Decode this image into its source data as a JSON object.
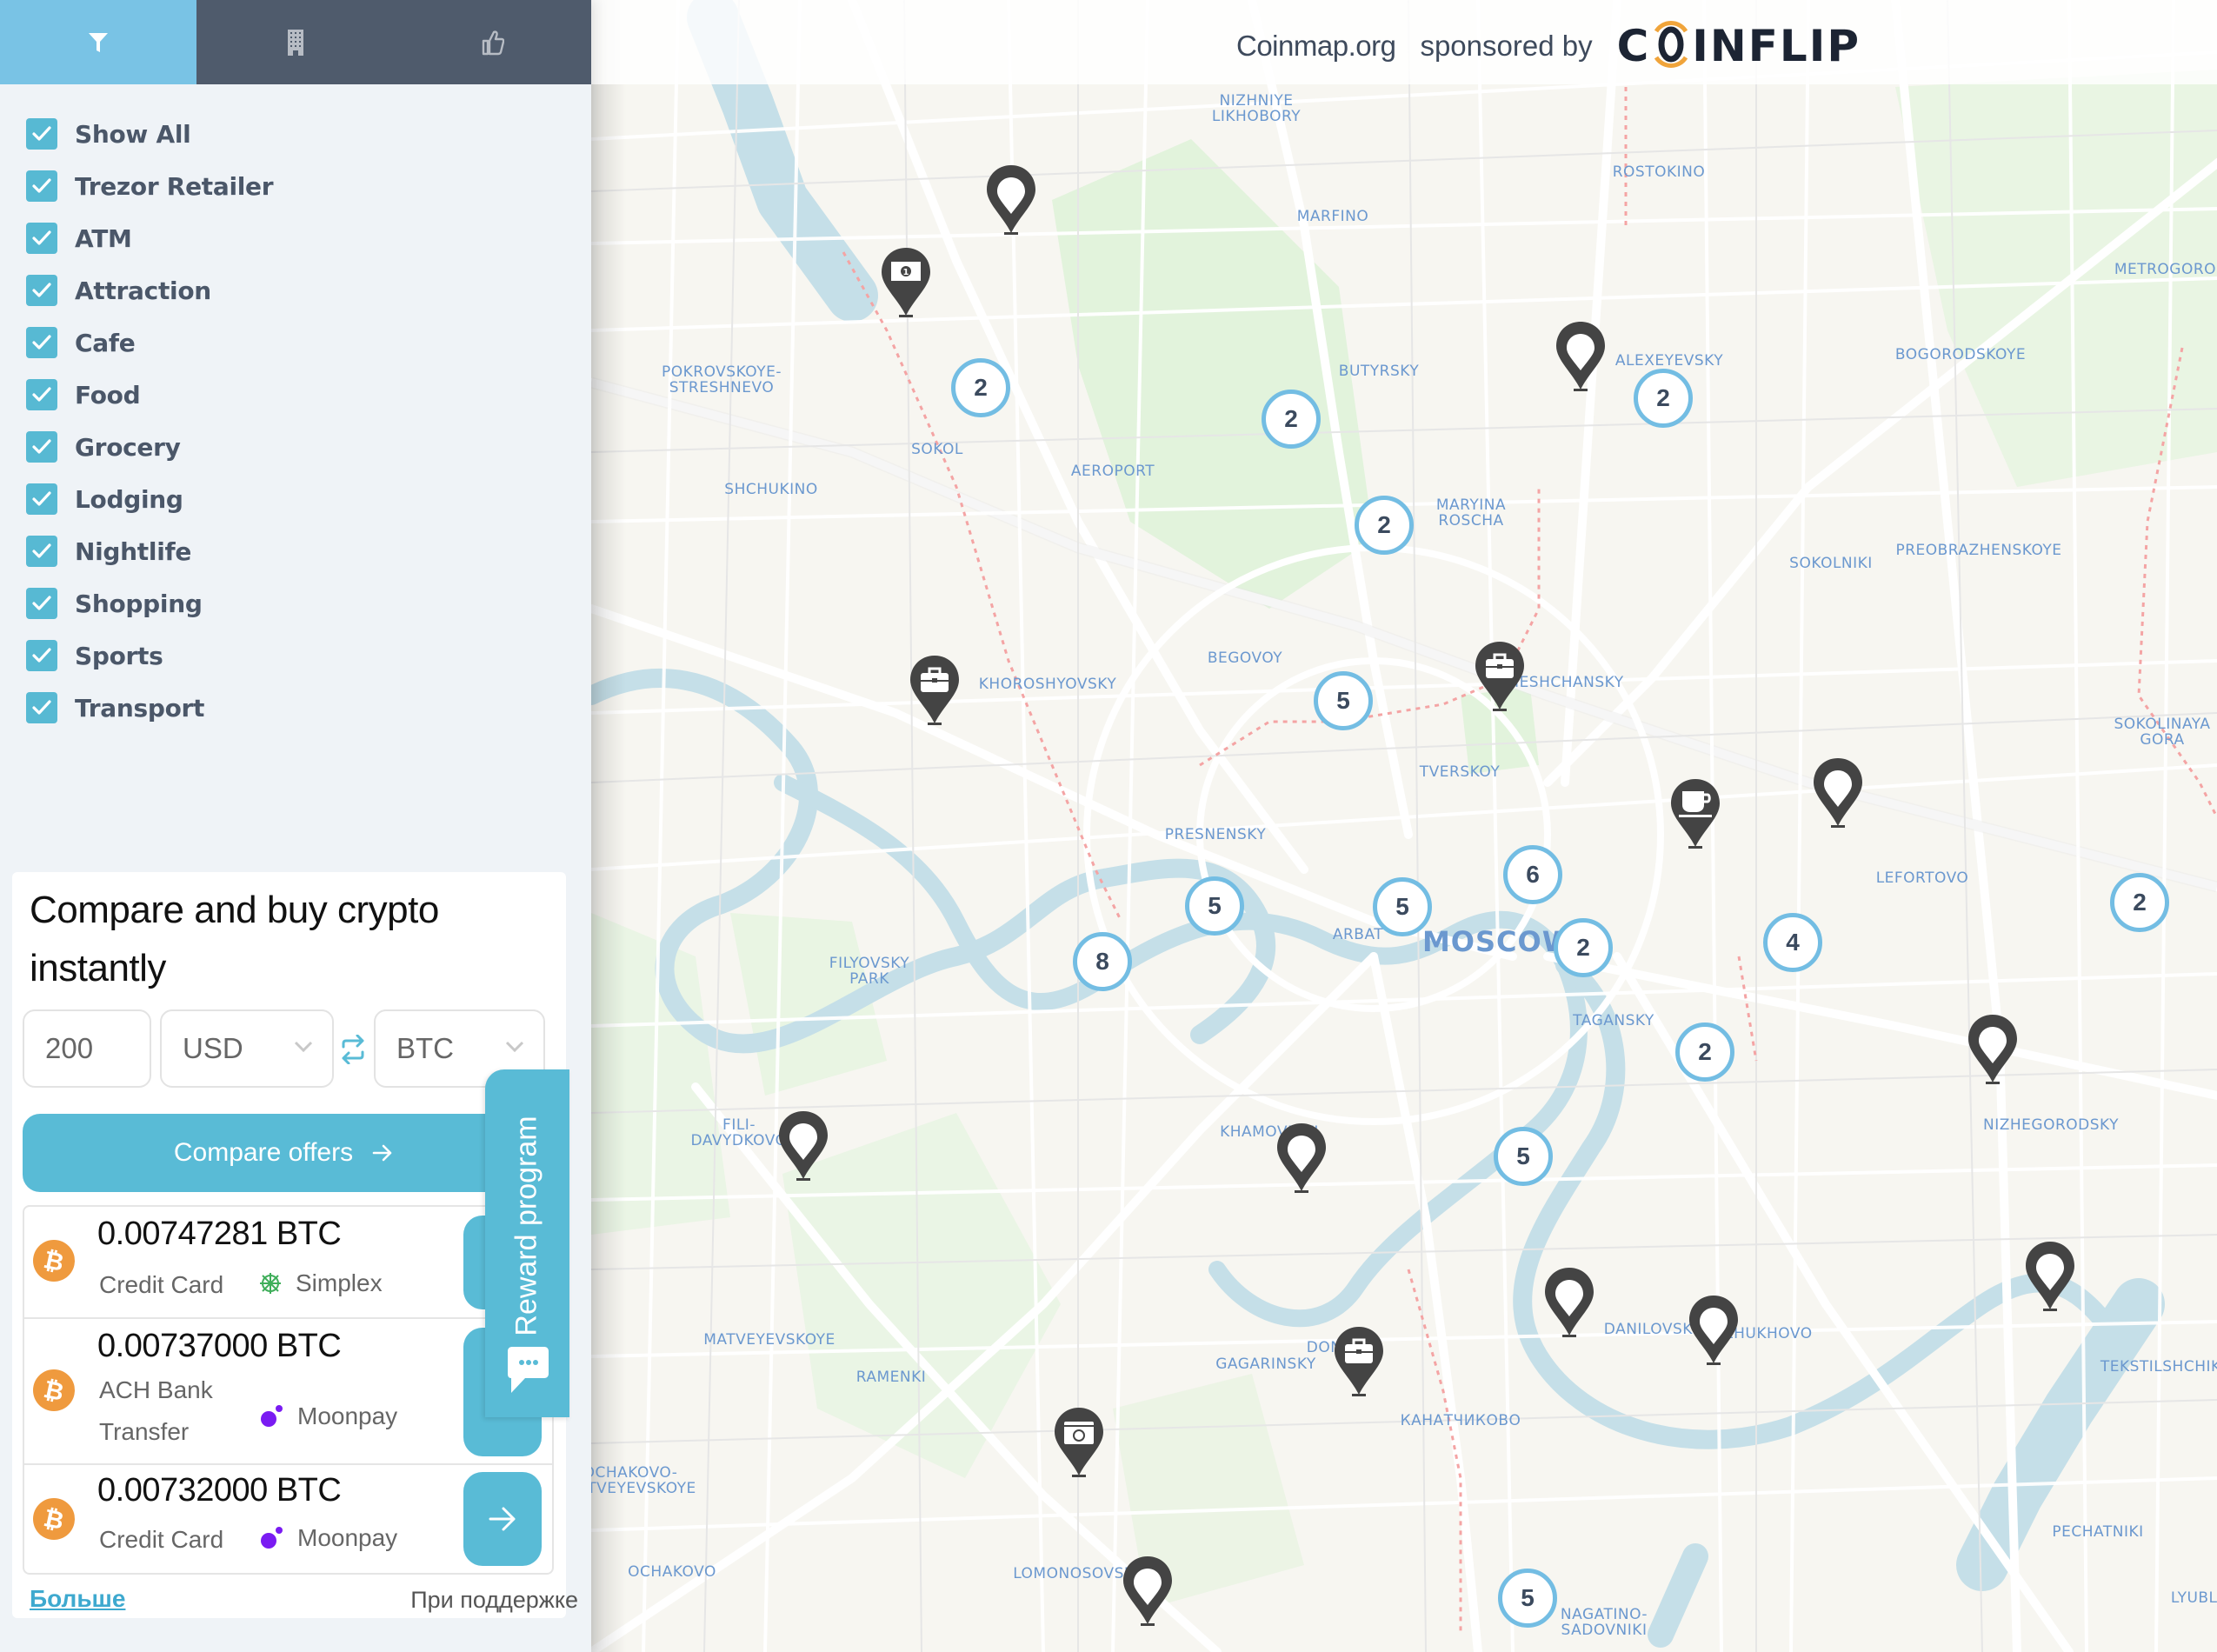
{
  "sidebar": {
    "tabs": [
      {
        "name": "filter",
        "icon": "filter-icon",
        "active": true
      },
      {
        "name": "venues",
        "icon": "building-icon",
        "active": false
      },
      {
        "name": "recommend",
        "icon": "thumbs-up-icon",
        "active": false
      }
    ],
    "filters": [
      {
        "label": "Show All",
        "checked": true
      },
      {
        "label": "Trezor Retailer",
        "checked": true
      },
      {
        "label": "ATM",
        "checked": true
      },
      {
        "label": "Attraction",
        "checked": true
      },
      {
        "label": "Cafe",
        "checked": true
      },
      {
        "label": "Food",
        "checked": true
      },
      {
        "label": "Grocery",
        "checked": true
      },
      {
        "label": "Lodging",
        "checked": true
      },
      {
        "label": "Nightlife",
        "checked": true
      },
      {
        "label": "Shopping",
        "checked": true
      },
      {
        "label": "Sports",
        "checked": true
      },
      {
        "label": "Transport",
        "checked": true
      }
    ]
  },
  "widget": {
    "title": "Compare and buy crypto instantly",
    "amount": "200",
    "from_currency": "USD",
    "to_currency": "BTC",
    "compare_label": "Compare offers",
    "offers": [
      {
        "amount": "0.00747281 BTC",
        "method": "Credit Card",
        "provider": "Simplex",
        "provider_icon": "simplex-icon"
      },
      {
        "amount": "0.00737000 BTC",
        "method": "ACH Bank Transfer",
        "provider": "Moonpay",
        "provider_icon": "moonpay-icon"
      },
      {
        "amount": "0.00732000 BTC",
        "method": "Credit Card",
        "provider": "Moonpay",
        "provider_icon": "moonpay-icon"
      }
    ],
    "more_link": "Больше",
    "powered_by": "При поддержке",
    "reward_tab": "Reward program"
  },
  "header": {
    "site": "Coinmap.org",
    "sponsored_by": "sponsored by",
    "sponsor": "COINFLIP"
  },
  "colors": {
    "accent": "#59bbd6",
    "tab_active": "#79c3e5",
    "tab_inactive": "#4f5b6c",
    "cluster_ring": "#73bde3",
    "pin": "#444444",
    "btc": "#ef9a3e",
    "moonpay": "#7a1bf2",
    "map_label": "#6b98cf"
  },
  "map": {
    "city": "MOSCOW",
    "labels": [
      "NIZHNIYE LIKHOBORY",
      "ROSTOKINO",
      "MARFINO",
      "METROGORODOK",
      "BOGORODSKOYE",
      "ALEXEYEVSKY",
      "BUTYRSKY",
      "POKROVSKOYE-STRESHNEVO",
      "SOKOL",
      "AEROPORT",
      "SHCHUKINO",
      "MARYINA ROSCHA",
      "PREOBRAZHENSKOYE",
      "SOKOLNIKI",
      "BEGOVOY",
      "KHOROSHYOVSKY",
      "MESHCHANSKY",
      "SOKOLINAYA GORA",
      "TVERSKOY",
      "PRESNENSKY",
      "LEFORTOVO",
      "ARBAT",
      "FILYOVSKY PARK",
      "TAGANSKY",
      "FILI-DAVYDKOVO",
      "KHAMOVNIKI",
      "NIZHEGORODSKY",
      "MATVEYEVSKOYE",
      "DANILOVSKY",
      "KOZHUKHOVO",
      "RAMENKI",
      "GAGARINSKY",
      "DONSKOY",
      "TEKSTILSHCHIKI",
      "КАНАТЧИКОВО",
      "OCHAKOVO-MATVEYEVSKOYE",
      "PECHATNIKI",
      "OCHAKOVO",
      "LOMONOSOVSKY",
      "NAGATINO-SADOVNIKI",
      "LYUBLINO"
    ],
    "clusters": [
      {
        "count": 2
      },
      {
        "count": 2
      },
      {
        "count": 2
      },
      {
        "count": 2
      },
      {
        "count": 5
      },
      {
        "count": 6
      },
      {
        "count": 5
      },
      {
        "count": 5
      },
      {
        "count": 2
      },
      {
        "count": 8
      },
      {
        "count": 4
      },
      {
        "count": 2
      },
      {
        "count": 2
      },
      {
        "count": 5
      },
      {
        "count": 5
      }
    ],
    "pins": [
      {
        "type": "default"
      },
      {
        "type": "atm"
      },
      {
        "type": "default"
      },
      {
        "type": "shopping"
      },
      {
        "type": "shopping"
      },
      {
        "type": "cafe"
      },
      {
        "type": "default"
      },
      {
        "type": "default"
      },
      {
        "type": "default"
      },
      {
        "type": "default"
      },
      {
        "type": "default"
      },
      {
        "type": "shopping"
      },
      {
        "type": "default"
      },
      {
        "type": "default"
      },
      {
        "type": "attraction"
      },
      {
        "type": "default"
      }
    ]
  }
}
